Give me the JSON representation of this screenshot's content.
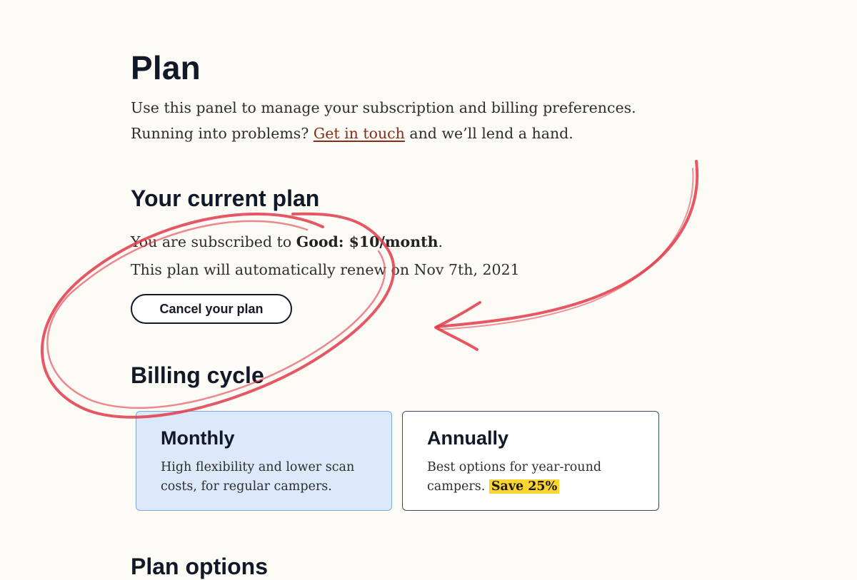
{
  "page": {
    "title": "Plan",
    "intro_line1": "Use this panel to manage your subscription and billing preferences.",
    "intro_line2_prefix": "Running into problems? ",
    "intro_link": "Get in touch",
    "intro_line2_suffix": " and we’ll lend a hand."
  },
  "current_plan": {
    "heading": "Your current plan",
    "subscribed_prefix": "You are subscribed to ",
    "plan_name": "Good: $10/month",
    "subscribed_suffix": ".",
    "renewal_text": "This plan will automatically renew on Nov 7th, 2021",
    "cancel_label": "Cancel your plan"
  },
  "billing_cycle": {
    "heading": "Billing cycle",
    "options": [
      {
        "title": "Monthly",
        "description": "High flexibility and lower scan costs, for regular campers.",
        "selected": true
      },
      {
        "title": "Annually",
        "description": "Best options for year-round campers. ",
        "badge": "Save 25%",
        "selected": false
      }
    ]
  },
  "plan_options": {
    "heading": "Plan options"
  },
  "colors": {
    "background": "#fcfbf6",
    "heading": "#111827",
    "link": "#8a2c1a",
    "selected_card": "#dce9fa",
    "highlight": "#fcd530",
    "annotation": "#e23a4a"
  }
}
